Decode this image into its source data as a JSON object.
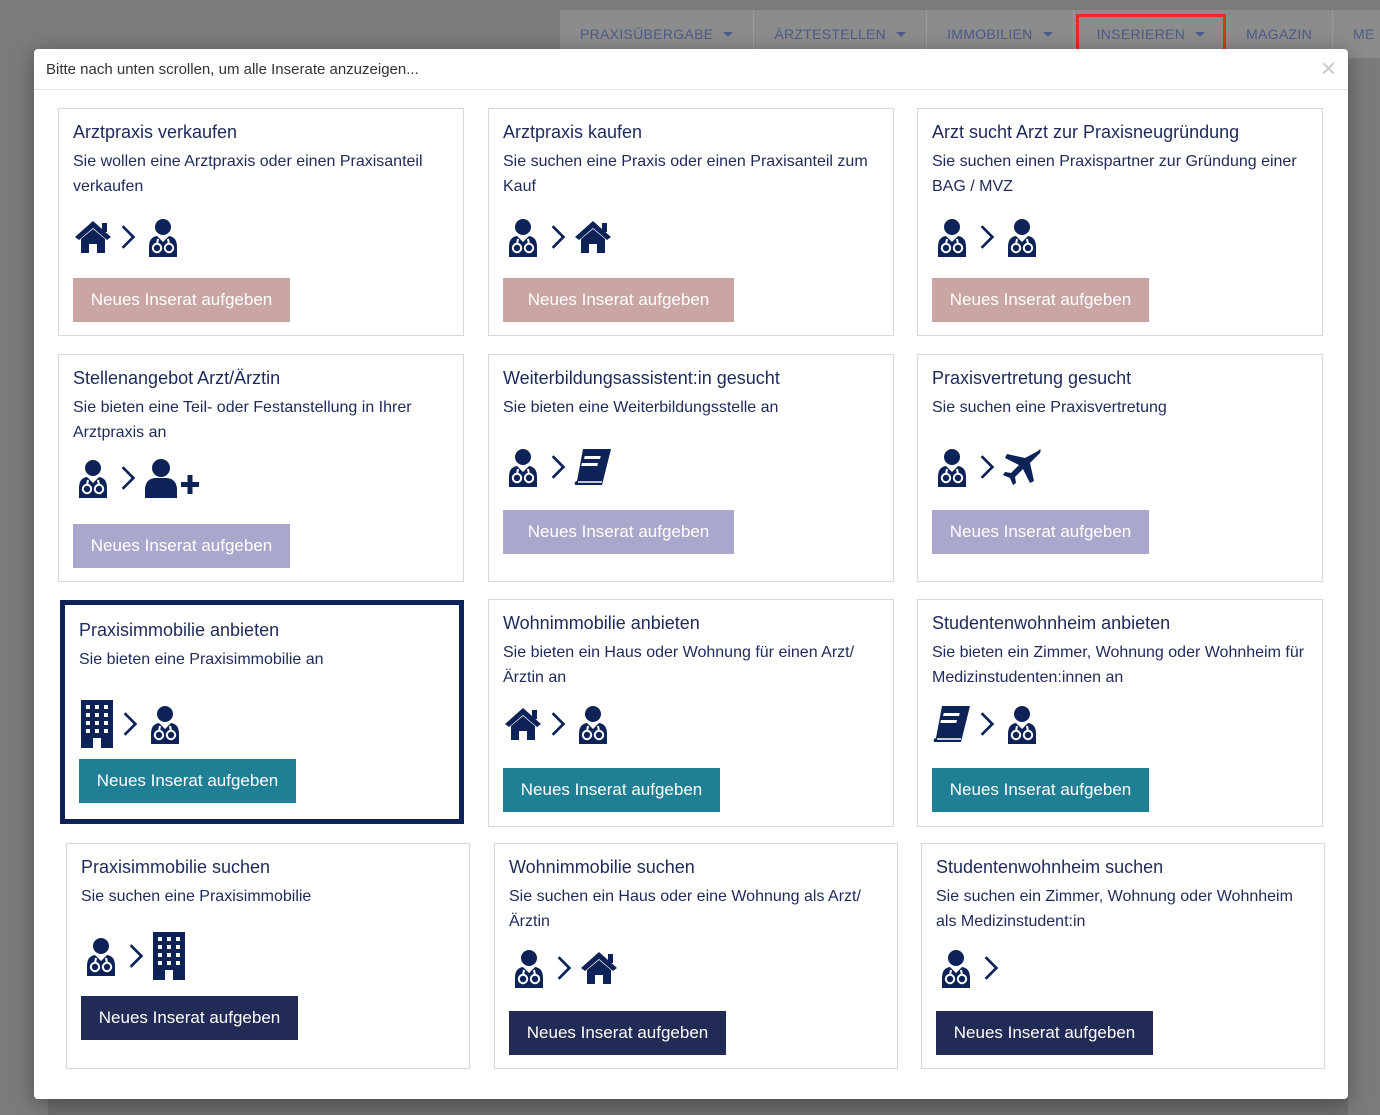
{
  "nav": {
    "items": [
      {
        "label": "PRAXISÜBERGABE"
      },
      {
        "label": "ÄRZTESTELLEN"
      },
      {
        "label": "IMMOBILIEN"
      },
      {
        "label": "INSERIEREN"
      },
      {
        "label": "MAGAZIN"
      },
      {
        "label": "ME"
      }
    ]
  },
  "modal": {
    "title": "Bitte nach unten scrollen, um alle Inserate anzuzeigen...",
    "close": "×"
  },
  "button_label": "Neues Inserat aufgeben",
  "cards": [
    {
      "title": "Arztpraxis verkaufen",
      "desc": "Sie wollen eine Arztpraxis oder einen Praxisanteil verkaufen",
      "icon_from": "house-icon",
      "icon_to": "doctor-icon",
      "button_color": "#c9a5a4"
    },
    {
      "title": "Arztpraxis kaufen",
      "desc": "Sie suchen eine Praxis oder einen Praxisanteil zum Kauf",
      "icon_from": "doctor-icon",
      "icon_to": "house-icon",
      "button_color": "#c9a5a4"
    },
    {
      "title": "Arzt sucht Arzt zur Praxisneugründung",
      "desc": "Sie suchen einen Praxispartner zur Gründung einer BAG / MVZ",
      "icon_from": "doctor-icon",
      "icon_to": "doctor-icon",
      "button_color": "#c9a5a4"
    },
    {
      "title": "Stellenangebot Arzt/Ärztin",
      "desc": "Sie bieten eine Teil- oder Festanstellung in Ihrer Arztpraxis an",
      "icon_from": "doctor-icon",
      "icon_to": "user-plus-icon",
      "button_color": "#a9a8cc"
    },
    {
      "title": "Weiterbildungsassistent:in gesucht",
      "desc": "Sie bieten eine Weiterbildungsstelle an",
      "icon_from": "doctor-icon",
      "icon_to": "book-icon",
      "button_color": "#a9a8cc"
    },
    {
      "title": "Praxisvertretung gesucht",
      "desc": "Sie suchen eine Praxisvertretung",
      "icon_from": "doctor-icon",
      "icon_to": "plane-icon",
      "button_color": "#a9a8cc"
    },
    {
      "title": "Praxisimmobilie anbieten",
      "desc": "Sie bieten eine Praxisimmobilie an",
      "icon_from": "building-icon",
      "icon_to": "doctor-icon",
      "button_color": "#1e7f95"
    },
    {
      "title": "Wohnimmobilie anbieten",
      "desc": "Sie bieten ein Haus oder Wohnung für einen Arzt/Ärztin an",
      "icon_from": "house-icon",
      "icon_to": "doctor-icon",
      "button_color": "#1e7f95"
    },
    {
      "title": "Studentenwohnheim anbieten",
      "desc": "Sie bieten ein Zimmer, Wohnung oder Wohnheim für Medizinstudenten:innen an",
      "icon_from": "book-icon",
      "icon_to": "doctor-icon",
      "button_color": "#1e7f95"
    },
    {
      "title": "Praxisimmobilie suchen",
      "desc": "Sie suchen eine Praxisimmobilie",
      "icon_from": "doctor-icon",
      "icon_to": "building-icon",
      "button_color": "#222b55"
    },
    {
      "title": "Wohnimmobilie suchen",
      "desc": "Sie suchen ein Haus oder eine Wohnung als Arzt/ Ärztin",
      "icon_from": "doctor-icon",
      "icon_to": "house-icon",
      "button_color": "#222b55"
    },
    {
      "title": "Studentenwohnheim suchen",
      "desc": "Sie suchen ein Zimmer, Wohnung oder Wohnheim als Medizinstudent:in",
      "icon_from": "doctor-icon",
      "icon_to": "",
      "button_color": "#222b55"
    }
  ]
}
